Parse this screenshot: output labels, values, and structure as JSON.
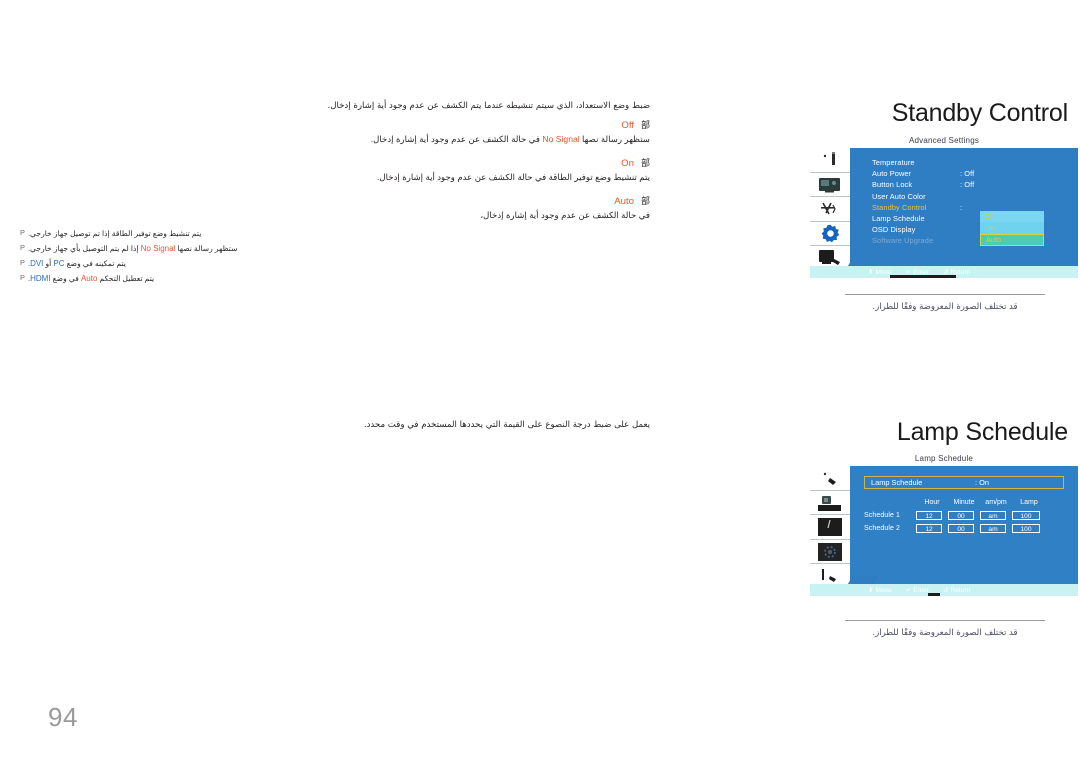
{
  "page": {
    "number": "94"
  },
  "sections": [
    {
      "id": "standby",
      "title": "Standby Control",
      "intro": "ضبط وضع الاستعداد، الذي سيتم تنشيطه عندما يتم الكشف عن عدم وجود أية إشارة إدخال.",
      "options": [
        {
          "bullet": "部",
          "name": "Off",
          "desc_before": "ستظهر رسالة نصها ",
          "en": "No Signal",
          "desc_after": " في حالة الكشف عن عدم وجود أية إشارة إدخال."
        },
        {
          "bullet": "部",
          "name": "On",
          "desc_before": "يتم تنشيط وضع توفير الطاقة في حالة الكشف عن عدم وجود أية إشارة إدخال.",
          "en": "",
          "desc_after": ""
        },
        {
          "bullet": "部",
          "name": "Auto",
          "desc_before": "في حالة الكشف عن عدم وجود أية إشارة إدخال،",
          "en": "",
          "desc_after": ""
        }
      ],
      "sub_items": [
        {
          "mark": "P",
          "before": "يتم تنشيط وضع توفير الطاقة إذا تم توصيل جهاز خارجي.",
          "en": "",
          "after": ""
        },
        {
          "mark": "P",
          "before": "ستظهر رسالة نصها ",
          "en": "No Signal",
          "after": " إذا لم يتم التوصيل بأي جهاز خارجي."
        },
        {
          "mark": "P",
          "before": "يتم تمكينه في وضع ",
          "en": "PC",
          "mid": " أو ",
          "en2": "DVI",
          "after": "."
        },
        {
          "mark": "P",
          "before": "يتم تعطيل التحكم ",
          "en": "Auto",
          "mid": " في وضع ",
          "en2": "HDMI",
          "after": "."
        }
      ]
    },
    {
      "id": "lamp",
      "title": "Lamp Schedule",
      "intro": "يعمل على ضبط درجة النصوع على القيمة التي يحددها المستخدم في وقت محدد."
    }
  ],
  "osd_standby": {
    "caption": "Advanced Settings",
    "rows": [
      {
        "label": "Temperature",
        "value": "",
        "state": "normal"
      },
      {
        "label": "Auto Power",
        "value": ": Off",
        "state": "normal"
      },
      {
        "label": "Button Lock",
        "value": ": Off",
        "state": "normal"
      },
      {
        "label": "User Auto Color",
        "value": "",
        "state": "normal"
      },
      {
        "label": "Standby Control",
        "value": ":",
        "state": "selected"
      },
      {
        "label": "Lamp Schedule",
        "value": "",
        "state": "normal"
      },
      {
        "label": "OSD Display",
        "value": "",
        "state": "normal"
      },
      {
        "label": "Software Upgrade",
        "value": "",
        "state": "dim"
      }
    ],
    "dropdown": [
      {
        "label": "Off",
        "active": false
      },
      {
        "label": "On",
        "active": false
      },
      {
        "label": "Auto",
        "active": true
      }
    ],
    "help": [
      {
        "icon": "updown-icon",
        "glyph": "⬍",
        "label": "Move"
      },
      {
        "icon": "enter-icon",
        "glyph": "↵",
        "label": "Enter"
      },
      {
        "icon": "return-icon",
        "glyph": "↺",
        "label": "Return"
      }
    ],
    "figure_caption": "قد تختلف الصورة المعروضة وفقًا للطراز."
  },
  "osd_lamp": {
    "caption": "Lamp Schedule",
    "topbar": {
      "label": "Lamp Schedule",
      "value": ": On"
    },
    "headers": [
      "Hour",
      "Minute",
      "am/pm",
      "Lamp"
    ],
    "rows": [
      {
        "label": "Schedule 1",
        "hour": "12",
        "minute": "00",
        "ampm": "am",
        "lamp": "100"
      },
      {
        "label": "Schedule 2",
        "hour": "12",
        "minute": "00",
        "ampm": "am",
        "lamp": "100"
      }
    ],
    "help": [
      {
        "icon": "updown-icon",
        "glyph": "⬍",
        "label": "Move"
      },
      {
        "icon": "enter-icon",
        "glyph": "↵",
        "label": "Enter"
      },
      {
        "icon": "return-icon",
        "glyph": "↺",
        "label": "Return"
      }
    ],
    "figure_caption": "قد تختلف الصورة المعروضة وفقًا للطراز."
  },
  "colors": {
    "osd_blue": "#2f7ec4",
    "accent_orange": "#e8552d",
    "highlight_yellow": "#f2c230",
    "dropdown_cyan": "#79d7f2",
    "dropdown_active": "#4ecbb4",
    "help_bar": "#c9f2f2",
    "page_gray": "#9a9a9a"
  }
}
